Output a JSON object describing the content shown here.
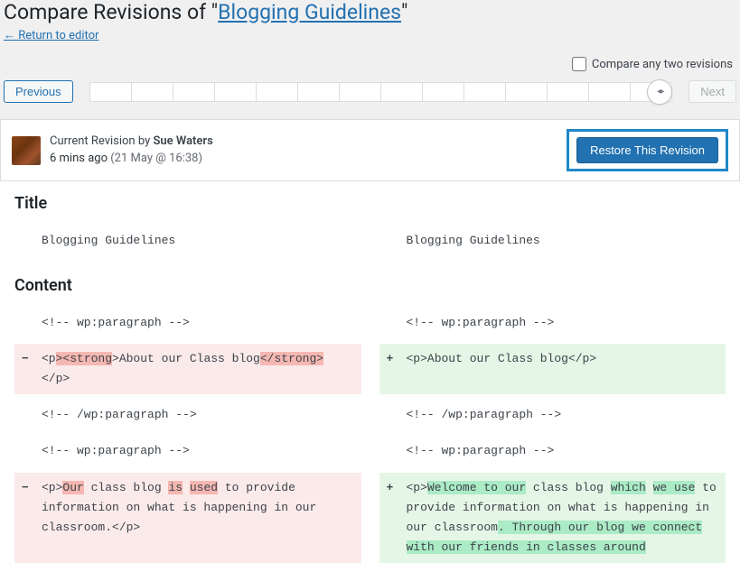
{
  "header": {
    "title_prefix": "Compare Revisions of \"",
    "title_link": "Blogging Guidelines",
    "title_suffix": "\"",
    "return_link": "← Return to editor"
  },
  "controls": {
    "compare_label": "Compare any two revisions",
    "previous": "Previous",
    "next": "Next"
  },
  "revision": {
    "current_by_prefix": "Current Revision by ",
    "author": "Sue Waters",
    "age": "6 mins ago ",
    "timestamp": "(21 May @ 16:38)",
    "restore": "Restore This Revision"
  },
  "diff": {
    "title_label": "Title",
    "content_label": "Content",
    "title_left": "Blogging Guidelines",
    "title_right": "Blogging Guidelines",
    "row1": {
      "left": "<!-- wp:paragraph -->",
      "right": "<!-- wp:paragraph -->"
    },
    "row2": {
      "left_p_open": "<p",
      "left_hl1": "><strong",
      "left_mid": ">About our Class blog",
      "left_hl2": "</strong>",
      "left_close": "</p>",
      "right": "<p>About our Class blog</p>"
    },
    "row3": {
      "left": "<!-- /wp:paragraph -->",
      "right": "<!-- /wp:paragraph -->"
    },
    "row4": {
      "left": "<!-- wp:paragraph -->",
      "right": "<!-- wp:paragraph -->"
    },
    "row5": {
      "left": {
        "p": "<p>",
        "h1": "Our",
        "t1": " class blog ",
        "h2": "is",
        "t2": " ",
        "h3": "used",
        "t3": " to provide information on what is happening in our classroom.</p>"
      },
      "right": {
        "p": "<p>",
        "h1": "Welcome to our",
        "t1": " class blog ",
        "h2": "which",
        "t2": " ",
        "h3": "we use",
        "t3": " to provide information on what is happening in our classroom",
        "h4": ". Through our blog we connect with our friends in classes around "
      }
    },
    "minus": "−",
    "plus": "+"
  }
}
